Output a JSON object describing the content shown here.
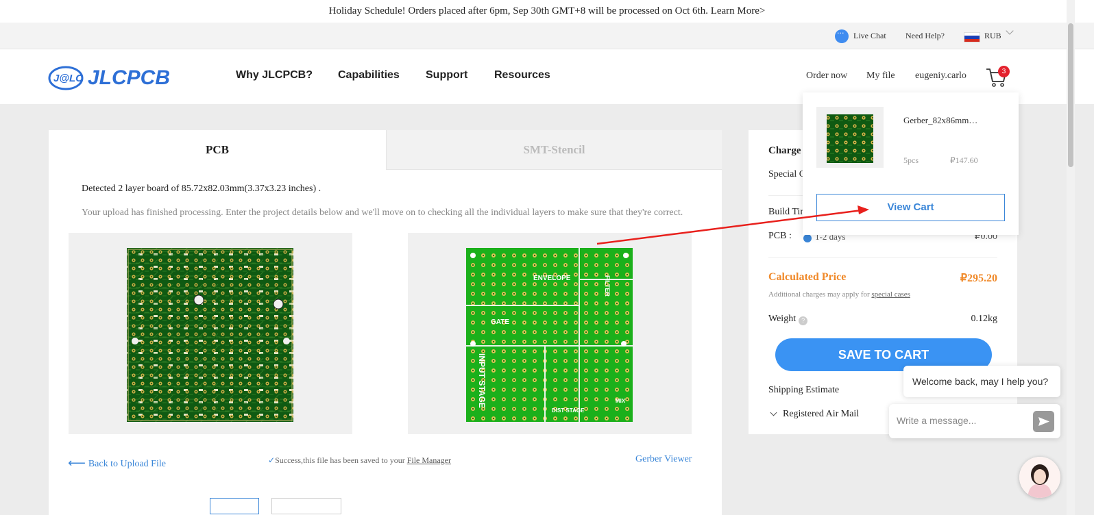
{
  "banner": {
    "text": "Holiday Schedule! Orders placed after 6pm, Sep 30th GMT+8 will be processed on Oct 6th. Learn More>"
  },
  "utility": {
    "live_chat": "Live Chat",
    "need_help": "Need Help?",
    "currency": "RUB"
  },
  "header": {
    "logo_text": "JLCPCB",
    "logo_mark": "J@LC",
    "nav": [
      "Why JLCPCB?",
      "Capabilities",
      "Support",
      "Resources"
    ],
    "order_now": "Order now",
    "my_file": "My file",
    "username": "eugeniy.carlo",
    "cart_count": "3"
  },
  "tabs": {
    "pcb": "PCB",
    "smt": "SMT-Stencil"
  },
  "upload": {
    "detected": "Detected 2 layer board of 85.72x82.03mm(3.37x3.23 inches) .",
    "processing": "Your upload has finished processing. Enter the project details below and we'll move on to checking all the individual layers to make sure that they're correct.",
    "back": "Back to Upload File",
    "success": "Success,this file has been saved to your",
    "file_manager": "File Manager",
    "gerber_viewer": "Gerber Viewer"
  },
  "silkscreen": {
    "envelope": "ENVELOPE",
    "filter": "FILTER",
    "gate": "GATE",
    "input_stage": "INPUT STAGE",
    "dist_stage": "DIST STAGE",
    "mix": "MIX"
  },
  "summary": {
    "charges_title": "Charge",
    "special": "Special C",
    "build_time": "Build Tin",
    "pcb_label": "PCB :",
    "pcb_days": "1-2 days",
    "pcb_price": "₽0.00",
    "calculated_label": "Calculated Price",
    "calculated_price": "₽295.20",
    "additional": "Additional charges may apply for",
    "special_cases": "special cases",
    "weight_label": "Weight",
    "weight_value": "0.12kg",
    "save": "SAVE TO CART",
    "shipping": "Shipping Estimate",
    "air_mail": "Registered Air Mail"
  },
  "cart_dropdown": {
    "item_name": "Gerber_82x86mm…",
    "item_qty": "5pcs",
    "item_price": "₽147.60",
    "view_cart": "View Cart"
  },
  "chat": {
    "welcome": "Welcome back, may I help you?",
    "placeholder": "Write a message..."
  },
  "colors": {
    "accent": "#3a93f3",
    "price": "#f08a2b",
    "pcb_dark": "#0f5a12",
    "pcb_bright": "#1bb01b",
    "annotation": "#e8201c"
  },
  "icons": [
    "live-chat-icon",
    "russia-flag-icon",
    "chevron-down-icon",
    "cart-icon",
    "back-arrow-icon",
    "check-icon",
    "help-icon",
    "send-icon",
    "agent-avatar-icon"
  ]
}
